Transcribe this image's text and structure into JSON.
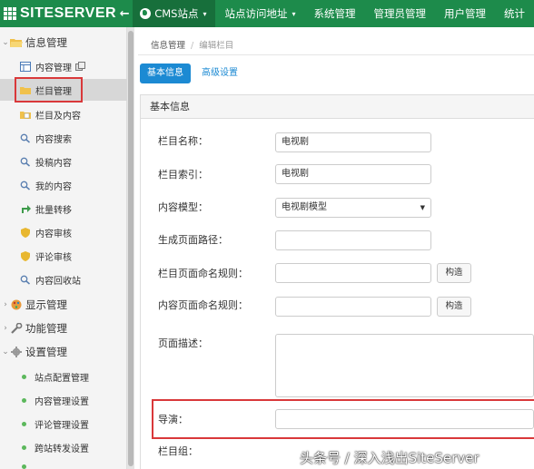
{
  "app": {
    "brand": "SITESERVER",
    "back_arrow": "←"
  },
  "topnav": {
    "items": [
      {
        "label": "CMS站点",
        "has_caret": true
      },
      {
        "label": "站点访问地址",
        "has_caret": true
      },
      {
        "label": "系统管理"
      },
      {
        "label": "管理员管理"
      },
      {
        "label": "用户管理"
      },
      {
        "label": "统计"
      }
    ],
    "caret": "▾"
  },
  "sidebar": {
    "groups": [
      {
        "label": "信息管理",
        "icon": "folder-open-icon"
      },
      {
        "label": "显示管理",
        "icon": "palette-icon"
      },
      {
        "label": "功能管理",
        "icon": "wrench-icon"
      },
      {
        "label": "设置管理",
        "icon": "gear-icon"
      }
    ],
    "info_items": [
      {
        "label": "内容管理",
        "icon": "table-icon",
        "extra_icon": "copy-icon"
      },
      {
        "label": "栏目管理",
        "icon": "folder-icon",
        "selected": true
      },
      {
        "label": "栏目及内容",
        "icon": "folder-doc-icon"
      },
      {
        "label": "内容搜索",
        "icon": "search-icon"
      },
      {
        "label": "投稿内容",
        "icon": "search-icon"
      },
      {
        "label": "我的内容",
        "icon": "search-icon"
      },
      {
        "label": "批量转移",
        "icon": "move-icon"
      },
      {
        "label": "内容审核",
        "icon": "shield-icon"
      },
      {
        "label": "评论审核",
        "icon": "shield-icon"
      },
      {
        "label": "内容回收站",
        "icon": "search-icon"
      }
    ],
    "settings_items": [
      {
        "label": "站点配置管理"
      },
      {
        "label": "内容管理设置"
      },
      {
        "label": "评论管理设置"
      },
      {
        "label": "跨站转发设置"
      }
    ],
    "chevron": "›"
  },
  "breadcrumb": {
    "parent": "信息管理",
    "separator": "/",
    "current": "编辑栏目"
  },
  "tabs": {
    "basic": "基本信息",
    "advanced": "高级设置"
  },
  "panel": {
    "title": "基本信息"
  },
  "form": {
    "channel_name_label": "栏目名称：",
    "channel_name_value": "电视剧",
    "channel_index_label": "栏目索引：",
    "channel_index_value": "电视剧",
    "content_model_label": "内容模型：",
    "content_model_value": "电视剧模型",
    "page_path_label": "生成页面路径：",
    "page_path_value": "",
    "channel_rule_label": "栏目页面命名规则：",
    "channel_rule_value": "",
    "content_rule_label": "内容页面命名规则：",
    "content_rule_value": "",
    "build_label": "构造",
    "description_label": "页面描述：",
    "director_label": "导演：",
    "director_value": "",
    "group_label": "栏目组："
  },
  "watermark": "头条号 / 深入浅出SiteServer",
  "colors": {
    "topbar": "#1d8b4b",
    "primary": "#1c8ad3",
    "annotation_red": "#d9383a"
  }
}
